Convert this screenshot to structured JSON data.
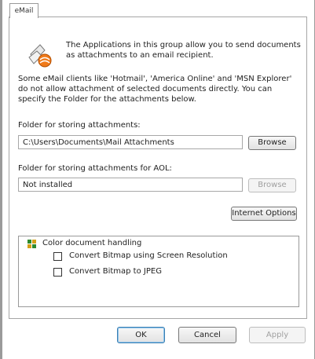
{
  "tab": {
    "label": "eMail"
  },
  "intro_text": "The Applications in this group allow you to send documents as attachments to an email recipient.",
  "info_text": "Some eMail clients like 'Hotmail', 'America Online' and 'MSN Explorer' do not allow attachment of selected documents directly. You can specify the Folder for the attachments below.",
  "attachments": {
    "label": "Folder for storing attachments:",
    "value": "C:\\Users\\Documents\\Mail Attachments",
    "browse_label": "Browse"
  },
  "aol": {
    "label": "Folder for storing attachments for AOL:",
    "value": "Not installed",
    "browse_label": "Browse"
  },
  "internet_options_label": "Internet Options",
  "color_handling": {
    "label": "Color document handling",
    "options": [
      {
        "label": "Convert Bitmap using Screen Resolution",
        "checked": false
      },
      {
        "label": "Convert Bitmap to JPEG",
        "checked": false
      }
    ]
  },
  "footer": {
    "ok": "OK",
    "cancel": "Cancel",
    "apply": "Apply"
  },
  "icons": {
    "app": "email-application-icon",
    "tree": "color-document-icon"
  }
}
